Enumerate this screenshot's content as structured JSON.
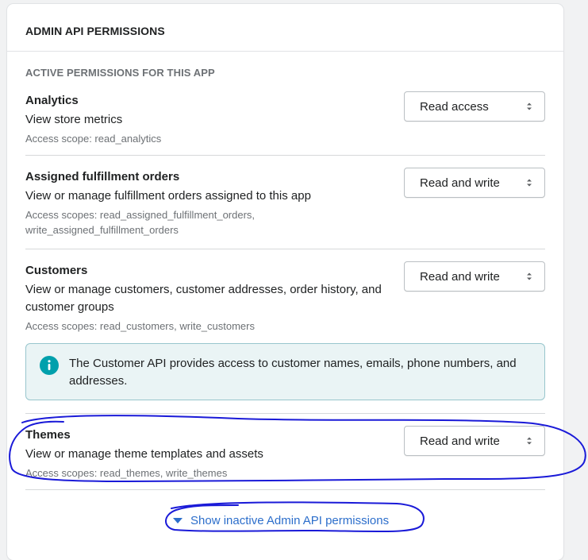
{
  "card": {
    "title": "ADMIN API PERMISSIONS"
  },
  "section": {
    "subtitle": "ACTIVE PERMISSIONS FOR THIS APP"
  },
  "permissions": [
    {
      "name": "Analytics",
      "description": "View store metrics",
      "scope": "Access scope: read_analytics",
      "access": "Read access"
    },
    {
      "name": "Assigned fulfillment orders",
      "description": "View or manage fulfillment orders assigned to this app",
      "scope": "Access scopes: read_assigned_fulfillment_orders, write_assigned_fulfillment_orders",
      "access": "Read and write"
    },
    {
      "name": "Customers",
      "description": "View or manage customers, customer addresses, order history, and customer groups",
      "scope": "Access scopes: read_customers, write_customers",
      "access": "Read and write"
    },
    {
      "name": "Themes",
      "description": "View or manage theme templates and assets",
      "scope": "Access scopes: read_themes, write_themes",
      "access": "Read and write"
    }
  ],
  "banner": {
    "icon": "info-icon",
    "text": "The Customer API provides access to customer names, emails, phone numbers, and addresses."
  },
  "footer": {
    "show_inactive_label": "Show inactive Admin API permissions"
  },
  "colors": {
    "link": "#2c6ecb",
    "annotation": "#1a1ad8",
    "banner_bg": "#eaf4f5",
    "info_icon": "#00a0ac"
  }
}
